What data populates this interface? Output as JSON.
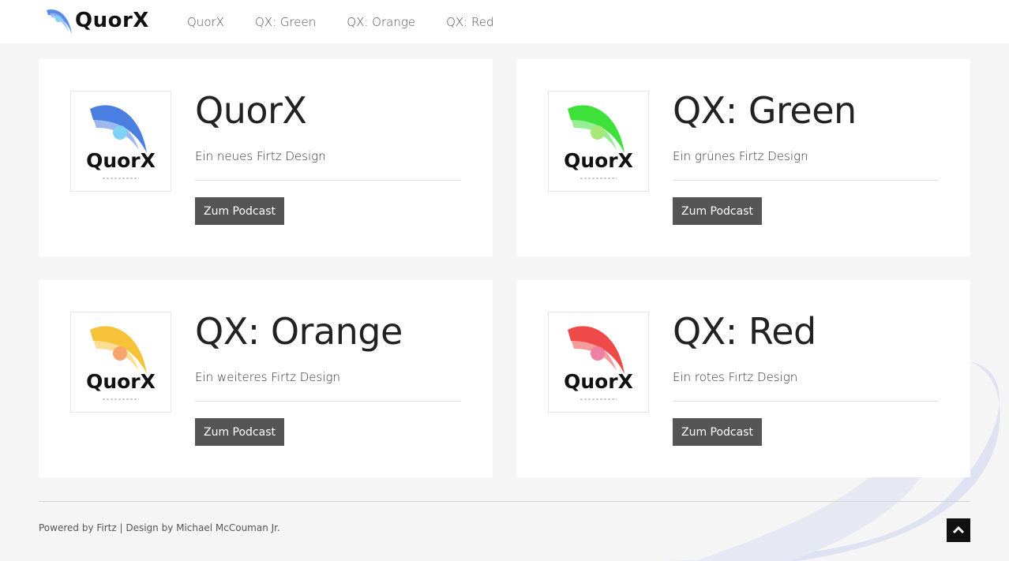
{
  "header": {
    "logo_text": "QuorX",
    "nav": [
      "QuorX",
      "QX: Green",
      "QX: Orange",
      "QX: Red"
    ]
  },
  "cards": [
    {
      "title": "QuorX",
      "subtitle": "Ein neues Firtz Design",
      "button": "Zum Podcast",
      "logo_text": "QuorX",
      "accent": "#4a7ee0",
      "dot": "#7fd2f5"
    },
    {
      "title": "QX: Green",
      "subtitle": "Ein grünes Firtz Design",
      "button": "Zum Podcast",
      "logo_text": "QuorX",
      "accent": "#3ee03a",
      "dot": "#a8e879"
    },
    {
      "title": "QX: Orange",
      "subtitle": "Ein weiteres Firtz Design",
      "button": "Zum Podcast",
      "logo_text": "QuorX",
      "accent": "#f6c23a",
      "dot": "#f7a56e"
    },
    {
      "title": "QX: Red",
      "subtitle": "Ein rotes Firtz Design",
      "button": "Zum Podcast",
      "logo_text": "QuorX",
      "accent": "#ef4a4a",
      "dot": "#ef7fa4"
    }
  ],
  "footer": {
    "text": "Powered by Firtz | Design by Michael McCouman Jr."
  },
  "colors": {
    "background": "#f5f5f5",
    "button": "#555555",
    "swoosh": "#d8dcf0"
  },
  "icons": {
    "logo": "quorx-swoosh-logo",
    "back_to_top": "chevron-up-icon"
  }
}
